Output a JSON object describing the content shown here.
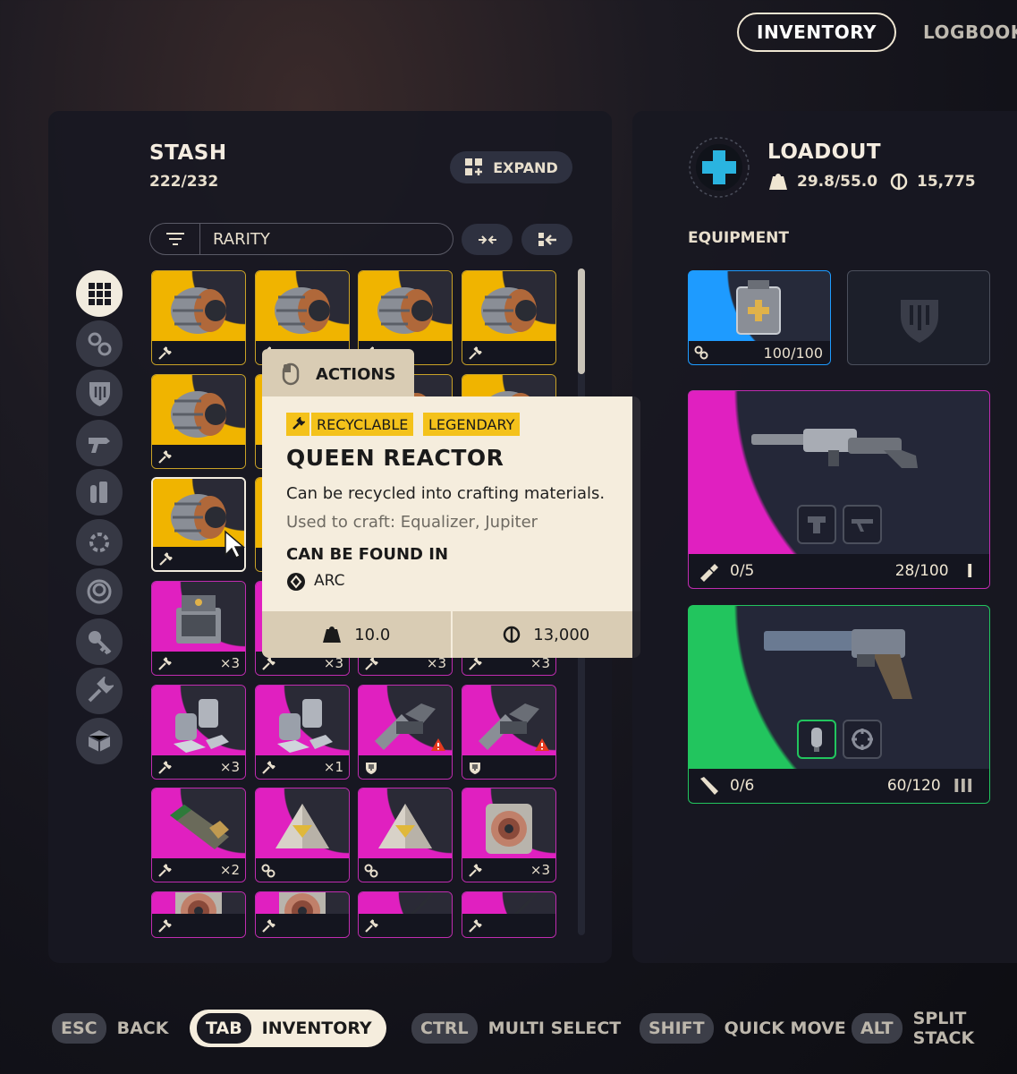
{
  "top_tabs": {
    "active": "INVENTORY",
    "inactive": "LOGBOOK"
  },
  "stash": {
    "title": "STASH",
    "capacity": "222/232",
    "expand_label": "EXPAND",
    "filter_label": "RARITY"
  },
  "categories": [
    "grid-icon",
    "materials-icon",
    "shield-icon",
    "weapon-icon",
    "ammo-icon",
    "mods-icon",
    "augment-icon",
    "keys-icon",
    "wrench-icon",
    "box-icon"
  ],
  "grid": [
    {
      "rarity": "legendary",
      "item": "reactor",
      "tag": "wrench",
      "qty": ""
    },
    {
      "rarity": "legendary",
      "item": "reactor",
      "tag": "wrench",
      "qty": ""
    },
    {
      "rarity": "legendary",
      "item": "reactor",
      "tag": "wrench",
      "qty": ""
    },
    {
      "rarity": "legendary",
      "item": "reactor",
      "tag": "wrench",
      "qty": ""
    },
    {
      "rarity": "legendary",
      "item": "reactor",
      "tag": "wrench",
      "qty": ""
    },
    {
      "rarity": "legendary",
      "item": "reactor",
      "tag": "wrench",
      "qty": ""
    },
    {
      "rarity": "legendary",
      "item": "reactor",
      "tag": "wrench",
      "qty": ""
    },
    {
      "rarity": "legendary",
      "item": "reactor",
      "tag": "wrench",
      "qty": ""
    },
    {
      "rarity": "legendary",
      "item": "reactor",
      "tag": "wrench",
      "qty": ""
    },
    {
      "rarity": "legendary",
      "item": "reactor",
      "tag": "wrench",
      "qty": ""
    },
    {
      "rarity": "legendary",
      "item": "reactor",
      "tag": "wrench",
      "qty": ""
    },
    {
      "rarity": "legendary",
      "item": "reactor",
      "tag": "wrench",
      "qty": ""
    },
    {
      "rarity": "epic",
      "item": "case",
      "tag": "wrench",
      "qty": "×3"
    },
    {
      "rarity": "epic",
      "item": "case",
      "tag": "wrench",
      "qty": "×3"
    },
    {
      "rarity": "epic",
      "item": "case",
      "tag": "wrench",
      "qty": "×3"
    },
    {
      "rarity": "epic",
      "item": "case",
      "tag": "wrench",
      "qty": "×3"
    },
    {
      "rarity": "epic",
      "item": "canisters",
      "tag": "wrench",
      "qty": "×3"
    },
    {
      "rarity": "epic",
      "item": "canisters",
      "tag": "wrench",
      "qty": "×1"
    },
    {
      "rarity": "epic",
      "item": "launcher",
      "tag": "shield",
      "qty": "",
      "warning": true
    },
    {
      "rarity": "epic",
      "item": "launcher",
      "tag": "shield",
      "qty": "",
      "warning": true
    },
    {
      "rarity": "epic",
      "item": "tube",
      "tag": "wrench",
      "qty": "×2"
    },
    {
      "rarity": "epic",
      "item": "pyramid",
      "tag": "materials",
      "qty": ""
    },
    {
      "rarity": "epic",
      "item": "pyramid",
      "tag": "materials",
      "qty": ""
    },
    {
      "rarity": "epic",
      "item": "coil",
      "tag": "wrench",
      "qty": "×3"
    },
    {
      "rarity": "epic",
      "item": "coil",
      "tag": "wrench",
      "qty": ""
    },
    {
      "rarity": "epic",
      "item": "coil",
      "tag": "wrench",
      "qty": ""
    },
    {
      "rarity": "epic",
      "item": "wire",
      "tag": "wrench",
      "qty": ""
    },
    {
      "rarity": "epic",
      "item": "wire",
      "tag": "wrench",
      "qty": ""
    }
  ],
  "tooltip": {
    "actions_label": "ACTIONS",
    "badges": [
      "RECYCLABLE",
      "LEGENDARY"
    ],
    "name": "QUEEN REACTOR",
    "description": "Can be recycled into crafting materials.",
    "used_to_craft": "Used to craft: Equalizer, Jupiter",
    "found_in_label": "CAN BE FOUND IN",
    "found_in_location": "ARC",
    "weight": "10.0",
    "value": "13,000"
  },
  "loadout": {
    "title": "LOADOUT",
    "weight": "29.8/55.0",
    "credits": "15,775",
    "equipment_label": "EQUIPMENT",
    "backpack_durability": "100/100",
    "weapon1": {
      "ammo": "0/5",
      "durability": "28/100",
      "tier": "I"
    },
    "weapon2": {
      "ammo": "0/6",
      "durability": "60/120",
      "tier": "III"
    }
  },
  "footer": [
    {
      "key": "ESC",
      "label": "BACK",
      "active": false
    },
    {
      "key": "TAB",
      "label": "INVENTORY",
      "active": true
    },
    {
      "key": "CTRL",
      "label": "MULTI SELECT",
      "active": false
    },
    {
      "key": "SHIFT",
      "label": "QUICK MOVE",
      "active": false
    },
    {
      "key": "ALT",
      "label": "SPLIT STACK",
      "active": false
    }
  ],
  "colors": {
    "legendary": "#f0b400",
    "epic": "#e020c0",
    "rare": "#1e9bff",
    "uncommon": "#22c55e",
    "cream": "#f5eddd"
  }
}
